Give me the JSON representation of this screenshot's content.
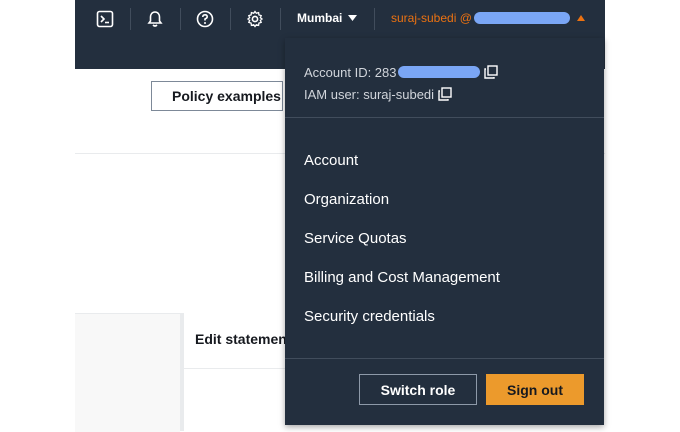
{
  "nav": {
    "region": "Mumbai",
    "account_prefix": "suraj-subedi @",
    "icons": [
      "cloudshell-icon",
      "bell-icon",
      "help-icon",
      "settings-icon"
    ]
  },
  "page": {
    "policy_examples_label": "Policy examples",
    "edit_statement_label": "Edit statemen"
  },
  "dropdown": {
    "account_id_label": "Account ID: 283",
    "iam_user_label": "IAM user: suraj-subedi",
    "menu": [
      "Account",
      "Organization",
      "Service Quotas",
      "Billing and Cost Management",
      "Security credentials"
    ],
    "switch_role_label": "Switch role",
    "sign_out_label": "Sign out"
  },
  "colors": {
    "nav_bg": "#232f3e",
    "accent": "#ec7211",
    "signout_bg": "#ec9a2c",
    "redaction": "#7aa6f5"
  }
}
